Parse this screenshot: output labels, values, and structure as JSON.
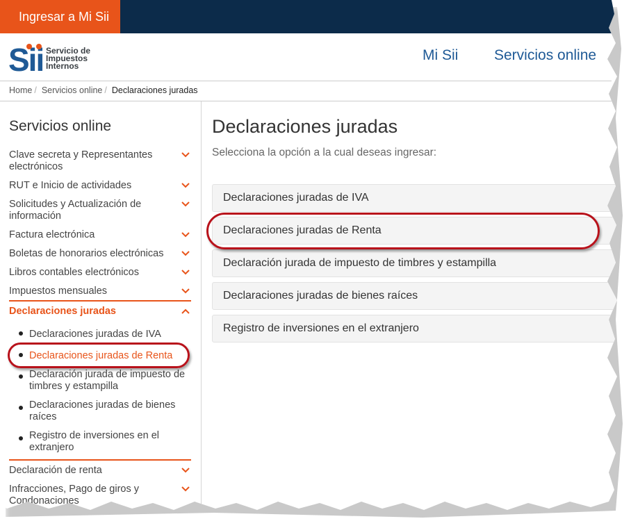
{
  "top_bar": {
    "login_label": "Ingresar a Mi Sii"
  },
  "logo": {
    "mark": "Sii",
    "lines": [
      "Servicio de",
      "Impuestos",
      "Internos"
    ],
    "color": "#1f5a96"
  },
  "nav": {
    "mi_sii": "Mi Sii",
    "servicios_online": "Servicios online"
  },
  "breadcrumb": {
    "home": "Home",
    "services": "Servicios online",
    "current": "Declaraciones juradas"
  },
  "sidebar": {
    "title": "Servicios online",
    "items": [
      {
        "label": "Clave secreta y Representantes electrónicos"
      },
      {
        "label": "RUT e Inicio de actividades"
      },
      {
        "label": "Solicitudes y Actualización de información"
      },
      {
        "label": "Factura electrónica"
      },
      {
        "label": "Boletas de honorarios electrónicas"
      },
      {
        "label": "Libros contables electrónicos"
      },
      {
        "label": "Impuestos mensuales"
      },
      {
        "label": "Declaraciones juradas"
      },
      {
        "label": "Declaración de renta"
      },
      {
        "label": "Infracciones, Pago de giros y Condonaciones"
      }
    ],
    "subitems": [
      {
        "label": "Declaraciones juradas de IVA"
      },
      {
        "label": "Declaraciones juradas de Renta"
      },
      {
        "label": "Declaración jurada de impuesto de timbres y estampilla"
      },
      {
        "label": "Declaraciones juradas de bienes raíces"
      },
      {
        "label": "Registro de inversiones en el extranjero"
      }
    ]
  },
  "main": {
    "title": "Declaraciones juradas",
    "subtitle": "Selecciona la opción a la cual deseas ingresar:",
    "options": [
      {
        "label": "Declaraciones juradas de IVA"
      },
      {
        "label": "Declaraciones juradas de Renta"
      },
      {
        "label": "Declaración jurada de impuesto de timbres y estampilla"
      },
      {
        "label": "Declaraciones juradas de bienes raíces"
      },
      {
        "label": "Registro de inversiones en el extranjero"
      }
    ]
  },
  "colors": {
    "brand_orange": "#e8541a",
    "top_bar": "#0c2b4a",
    "link_blue": "#1f5a96",
    "annotation_red": "#b8121b"
  }
}
